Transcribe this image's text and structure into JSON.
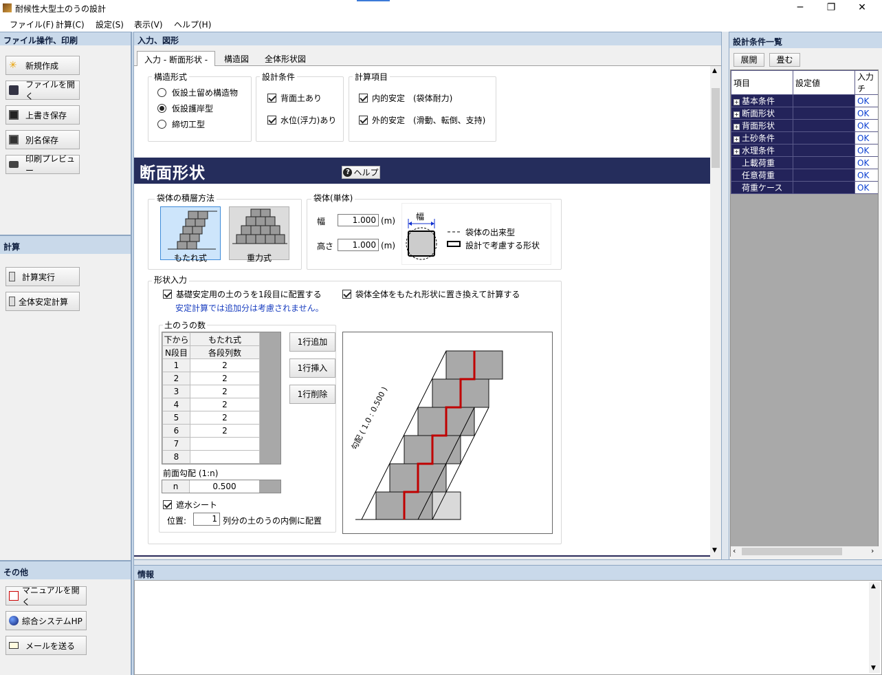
{
  "window": {
    "title": "耐候性大型土のうの設計",
    "min": "─",
    "restore": "❐",
    "close": "✕"
  },
  "menu": [
    "ファイル(F)",
    "計算(C)",
    "設定(S)",
    "表示(V)",
    "ヘルプ(H)"
  ],
  "left": {
    "file_header": "ファイル操作、印刷",
    "file_buttons": [
      "新規作成",
      "ファイルを開く",
      "上書き保存",
      "別名保存",
      "印刷プレビュー"
    ],
    "calc_header": "計算",
    "calc_buttons": [
      "計算実行",
      "全体安定計算"
    ],
    "other_header": "その他",
    "other_buttons": [
      "マニュアルを開く",
      "綜合システムHP",
      "メールを送る"
    ]
  },
  "center": {
    "header": "入力、図形",
    "tabs": [
      "入力 - 断面形状 -",
      "構造図",
      "全体形状図"
    ],
    "structure": {
      "title": "構造形式",
      "options": [
        "仮設土留め構造物",
        "仮設護岸型",
        "締切工型"
      ],
      "selected": 1
    },
    "design": {
      "title": "設計条件",
      "items": [
        {
          "label": "背面土あり",
          "checked": true
        },
        {
          "label": "水位(浮力)あり",
          "checked": true
        }
      ]
    },
    "calc_items": {
      "title": "計算項目",
      "items": [
        {
          "label": "内的安定　(袋体耐力)",
          "checked": true
        },
        {
          "label": "外的安定　(滑動、転倒、支持)",
          "checked": true
        }
      ]
    },
    "section_title": "断面形状",
    "help_button": "ヘルプ",
    "stacking": {
      "title": "袋体の積層方法",
      "options": [
        "もたれ式",
        "重力式"
      ],
      "selected": 0
    },
    "bag": {
      "title": "袋体(単体)",
      "width_label": "幅",
      "width_value": "1.000",
      "height_label": "高さ",
      "height_value": "1.000",
      "unit": "(m)",
      "diagram_label": "幅",
      "legend_dash": "袋体の出来型",
      "legend_solid": "設計で考慮する形状"
    },
    "shape": {
      "title": "形状入力",
      "check1": "基礎安定用の土のうを1段目に配置する",
      "check1_checked": true,
      "note": "安定計算では追加分は考慮されません。",
      "check2": "袋体全体をもたれ形状に置き換えて計算する",
      "check2_checked": true,
      "count_label": "土のうの数",
      "table_head1": [
        "下から",
        "もたれ式"
      ],
      "table_head2": [
        "N段目",
        "各段列数"
      ],
      "rows": [
        [
          "1",
          "2"
        ],
        [
          "2",
          "2"
        ],
        [
          "3",
          "2"
        ],
        [
          "4",
          "2"
        ],
        [
          "5",
          "2"
        ],
        [
          "6",
          "2"
        ],
        [
          "7",
          ""
        ],
        [
          "8",
          ""
        ]
      ],
      "buttons": [
        "1行追加",
        "1行挿入",
        "1行削除"
      ],
      "slope_label": "前面勾配 (1:n)",
      "n_label": "n",
      "n_value": "0.500",
      "sheet_label": "遮水シート",
      "sheet_checked": true,
      "position_label": "位置:",
      "position_value": "1",
      "position_suffix": "列分の土のうの内側に配置",
      "diagram_text": "勾配 ( 1.0 : 0.500 )"
    }
  },
  "right": {
    "header": "設計条件一覧",
    "expand": "展開",
    "collapse": "畳む",
    "columns": [
      "項目",
      "設定値",
      "入力チ"
    ],
    "rows": [
      {
        "name": "基本条件",
        "tree": true,
        "status": "OK"
      },
      {
        "name": "断面形状",
        "tree": true,
        "status": "OK"
      },
      {
        "name": "背面形状",
        "tree": true,
        "status": "OK"
      },
      {
        "name": "土砂条件",
        "tree": true,
        "status": "OK"
      },
      {
        "name": "水理条件",
        "tree": true,
        "status": "OK"
      },
      {
        "name": "上載荷重",
        "tree": false,
        "status": "OK"
      },
      {
        "name": "任意荷重",
        "tree": false,
        "status": "OK"
      },
      {
        "name": "荷重ケース",
        "tree": false,
        "status": "OK"
      }
    ]
  },
  "info": {
    "header": "情報"
  }
}
